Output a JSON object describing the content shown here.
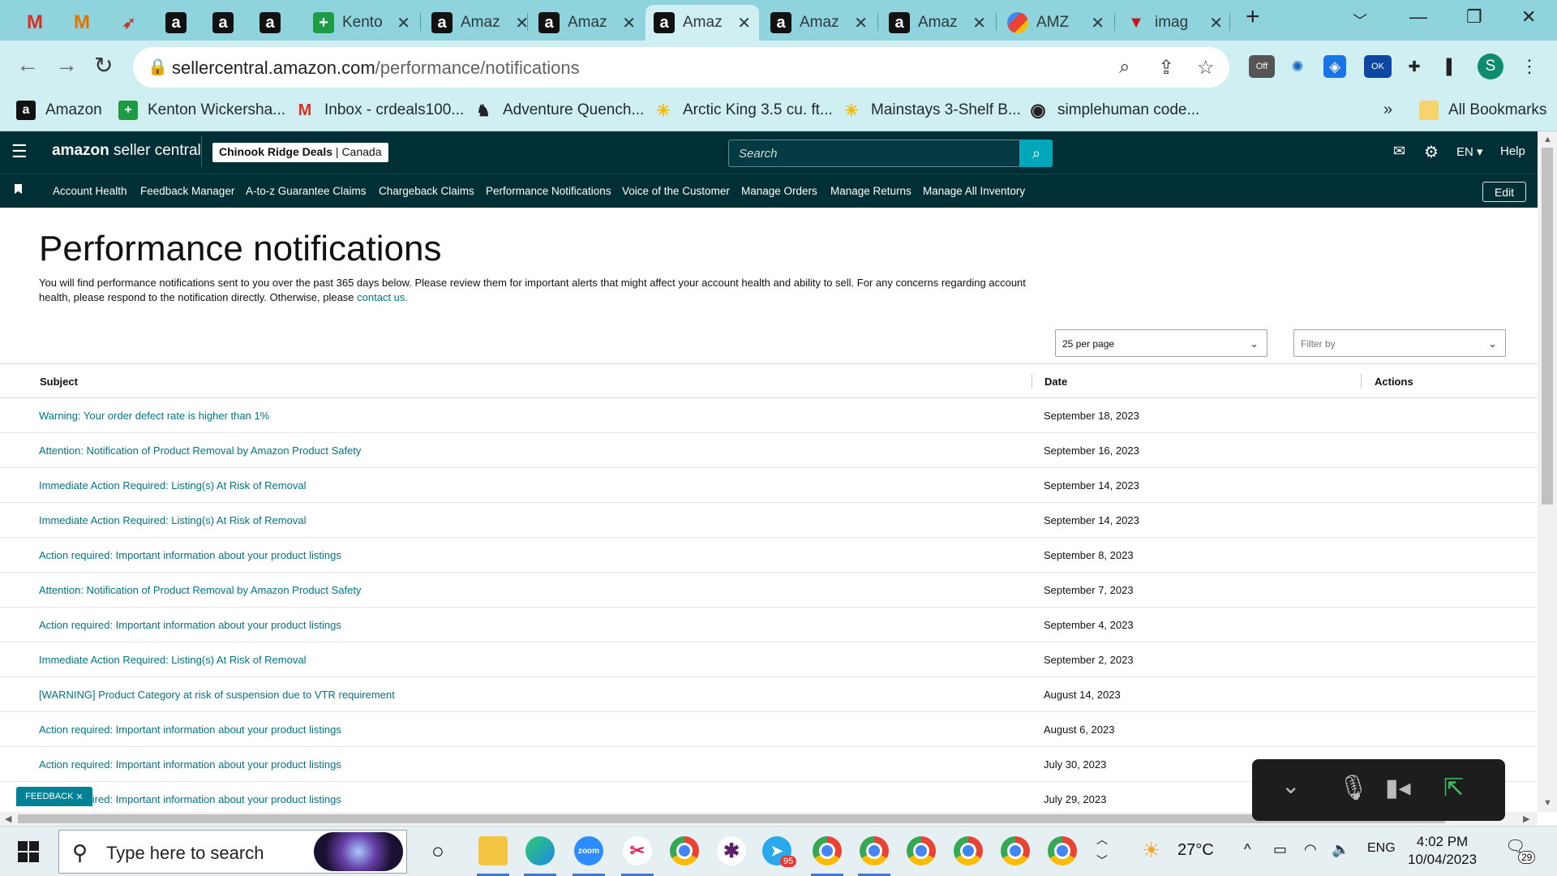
{
  "browser": {
    "tabs": [
      {
        "icon": "gmail-icon",
        "title": ""
      },
      {
        "icon": "gmail-icon",
        "title": ""
      },
      {
        "icon": "swoosh-icon",
        "title": ""
      },
      {
        "icon": "amazon-icon",
        "title": ""
      },
      {
        "icon": "amazon-icon",
        "title": ""
      },
      {
        "icon": "amazon-icon",
        "title": ""
      },
      {
        "icon": "sheets-plus-icon",
        "title": "Kento"
      },
      {
        "icon": "amazon-icon",
        "title": "Amaz"
      },
      {
        "icon": "amazon-icon",
        "title": "Amaz"
      },
      {
        "icon": "amazon-icon",
        "title": "Amaz",
        "active": true
      },
      {
        "icon": "amazon-icon",
        "title": "Amaz"
      },
      {
        "icon": "amazon-icon",
        "title": "Amaz"
      },
      {
        "icon": "multicolor-icon",
        "title": "AMZ"
      },
      {
        "icon": "image-icon",
        "title": "imag"
      }
    ],
    "url_host": "sellercentral.amazon.com",
    "url_path": "/performance/notifications",
    "bookmarks": [
      "Amazon",
      "Kenton Wickersha...",
      "Inbox - crdeals100...",
      "Adventure Quench...",
      "Arctic King 3.5 cu. ft...",
      "Mainstays 3-Shelf B...",
      "simplehuman code..."
    ],
    "all_bookmarks": "All Bookmarks",
    "profile_initial": "S",
    "ext_off_label": "Off",
    "ext_ok_label": "OK"
  },
  "seller_central": {
    "logo_text_bold": "amazon",
    "logo_text": " seller central",
    "store_name": "Chinook Ridge Deals",
    "store_region": " | Canada",
    "search_placeholder": "Search",
    "language": "EN",
    "help": "Help",
    "nav": [
      "Account Health",
      "Feedback Manager",
      "A-to-z Guarantee Claims",
      "Chargeback Claims",
      "Performance Notifications",
      "Voice of the Customer",
      "Manage Orders",
      "Manage Returns",
      "Manage All Inventory"
    ],
    "edit_label": "Edit"
  },
  "page": {
    "title": "Performance notifications",
    "description": "You will find performance notifications sent to you over the past 365 days below. Please review them for important alerts that might affect your account health and ability to sell. For any concerns regarding account health, please respond to the notification directly. Otherwise, please ",
    "contact_link": "contact us.",
    "per_page_value": "25 per page",
    "filter_placeholder": "Filter by"
  },
  "table": {
    "headers": {
      "subject": "Subject",
      "date": "Date",
      "actions": "Actions"
    },
    "rows": [
      {
        "subject": "Warning: Your order defect rate is higher than 1%",
        "date": "September 18, 2023"
      },
      {
        "subject": "Attention: Notification of Product Removal by Amazon Product Safety",
        "date": "September 16, 2023"
      },
      {
        "subject": "Immediate Action Required: Listing(s) At Risk of Removal",
        "date": "September 14, 2023"
      },
      {
        "subject": "Immediate Action Required: Listing(s) At Risk of Removal",
        "date": "September 14, 2023"
      },
      {
        "subject": "Action required: Important information about your product listings",
        "date": "September 8, 2023"
      },
      {
        "subject": "Attention: Notification of Product Removal by Amazon Product Safety",
        "date": "September 7, 2023"
      },
      {
        "subject": "Action required: Important information about your product listings",
        "date": "September 4, 2023"
      },
      {
        "subject": "Immediate Action Required: Listing(s) At Risk of Removal",
        "date": "September 2, 2023"
      },
      {
        "subject": "[WARNING] Product Category at risk of suspension due to VTR requirement",
        "date": "August 14, 2023"
      },
      {
        "subject": "Action required: Important information about your product listings",
        "date": "August 6, 2023"
      },
      {
        "subject": "Action required: Important information about your product listings",
        "date": "July 30, 2023"
      },
      {
        "subject": "Action required: Important information about your product listings",
        "date": "July 29, 2023"
      }
    ]
  },
  "feedback_label": "FEEDBACK",
  "taskbar": {
    "search_text": "Type here to search",
    "zoom_label": "zoom",
    "telegram_badge": "95",
    "temperature": "27°C",
    "language": "ENG",
    "time": "4:02 PM",
    "date": "10/04/2023",
    "notifications": "29"
  },
  "colors": {
    "tabstrip": "#8fd3dc",
    "toolbar": "#cfeff3",
    "sc_header": "#002f36",
    "link": "#00748a"
  }
}
